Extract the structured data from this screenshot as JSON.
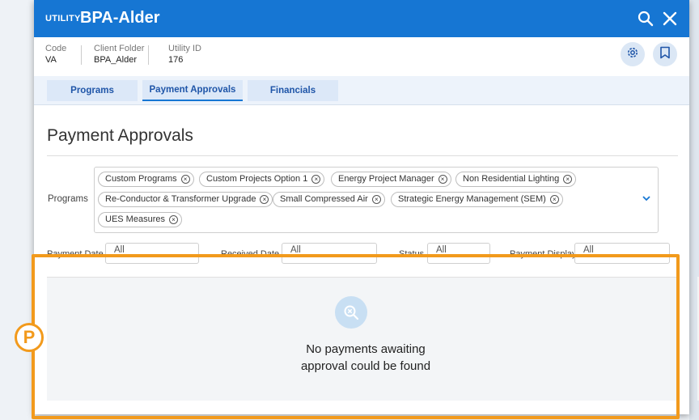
{
  "titlebar": {
    "tag": "UTILITY",
    "title": "BPA-Alder",
    "color": "#1676d3"
  },
  "meta": [
    {
      "label": "Code",
      "value": "VA"
    },
    {
      "label": "Client Folder",
      "value": "BPA_Alder"
    },
    {
      "label": "Utility ID",
      "value": "176"
    }
  ],
  "icons": {
    "search": "search-icon",
    "close": "close-icon",
    "settings": "gear-icon",
    "bookmark": "bookmark-icon"
  },
  "tabs": [
    {
      "label": "Programs",
      "active": false
    },
    {
      "label": "Payment Approvals",
      "active": true
    },
    {
      "label": "Financials",
      "active": false
    }
  ],
  "page_title": "Payment Approvals",
  "programs": {
    "label": "Programs",
    "chips": [
      "Custom Programs",
      "Custom Projects Option 1",
      "Energy Project Manager",
      "Non Residential Lighting",
      "Re-Conductor & Transformer Upgrade",
      "Small Compressed Air",
      "Strategic Energy Management (SEM)",
      "UES Measures"
    ]
  },
  "filters": [
    {
      "label": "Payment Date",
      "value": "All"
    },
    {
      "label": "Received Date",
      "value": "All"
    },
    {
      "label": "Status",
      "value": "All"
    },
    {
      "label": "Payment Display",
      "value": "All"
    }
  ],
  "empty_state": {
    "line1": "No payments awaiting",
    "line2": "approval could be found"
  },
  "annotation": {
    "badge": "P",
    "color": "#f29a1c"
  }
}
